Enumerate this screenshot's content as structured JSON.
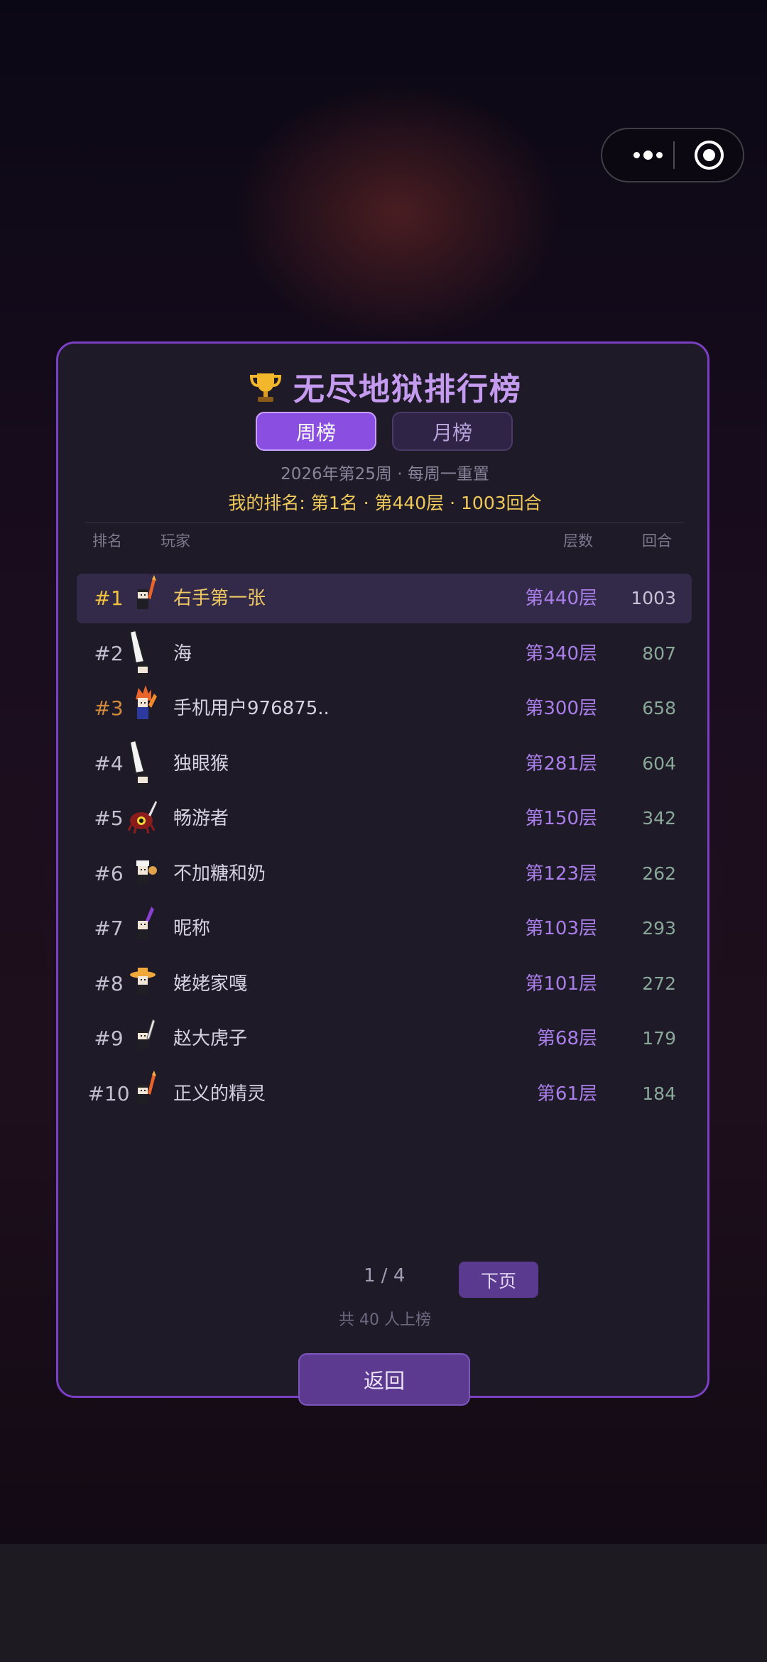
{
  "leaderboard": {
    "title": "无尽地狱排行榜",
    "tabs": {
      "weekly": "周榜",
      "monthly": "月榜"
    },
    "active_tab": "weekly",
    "subtitle": "2026年第25周 · 每周一重置",
    "my_rank": "我的排名: 第1名 · 第440层 · 1003回合",
    "headers": {
      "rank": "排名",
      "player": "玩家",
      "floor": "层数",
      "rounds": "回合"
    },
    "rows": [
      {
        "rank": "#1",
        "name": "右手第一张",
        "floor": "第440层",
        "rounds": "1003",
        "avatar": "knight-fire-sword-avatar"
      },
      {
        "rank": "#2",
        "name": "海",
        "floor": "第340层",
        "rounds": "807",
        "avatar": "knight-big-sword-avatar"
      },
      {
        "rank": "#3",
        "name": "手机用户976875..",
        "floor": "第300层",
        "rounds": "658",
        "avatar": "fire-hair-avatar"
      },
      {
        "rank": "#4",
        "name": "独眼猴",
        "floor": "第281层",
        "rounds": "604",
        "avatar": "knight-big-sword-avatar"
      },
      {
        "rank": "#5",
        "name": "畅游者",
        "floor": "第150层",
        "rounds": "342",
        "avatar": "red-eye-monster-avatar"
      },
      {
        "rank": "#6",
        "name": "不加糖和奶",
        "floor": "第123层",
        "rounds": "262",
        "avatar": "white-hat-avatar"
      },
      {
        "rank": "#7",
        "name": "昵称",
        "floor": "第103层",
        "rounds": "293",
        "avatar": "purple-feather-avatar"
      },
      {
        "rank": "#8",
        "name": "姥姥家嘎",
        "floor": "第101层",
        "rounds": "272",
        "avatar": "straw-hat-avatar"
      },
      {
        "rank": "#9",
        "name": "赵大虎子",
        "floor": "第68层",
        "rounds": "179",
        "avatar": "knight-sword-avatar"
      },
      {
        "rank": "#10",
        "name": "正义的精灵",
        "floor": "第61层",
        "rounds": "184",
        "avatar": "knight-fire-sword-avatar"
      }
    ],
    "pagination": {
      "page": "1 / 4",
      "next": "下页"
    },
    "total": "共 40 人上榜",
    "back": "返回"
  },
  "colors": {
    "accent": "#8a4fe0",
    "panel_border": "#7b3fc4",
    "gold": "#f0c23e",
    "floor": "#a97ee8"
  },
  "capsule": {
    "more_icon": "more-dots-icon",
    "close_icon": "target-close-icon"
  }
}
